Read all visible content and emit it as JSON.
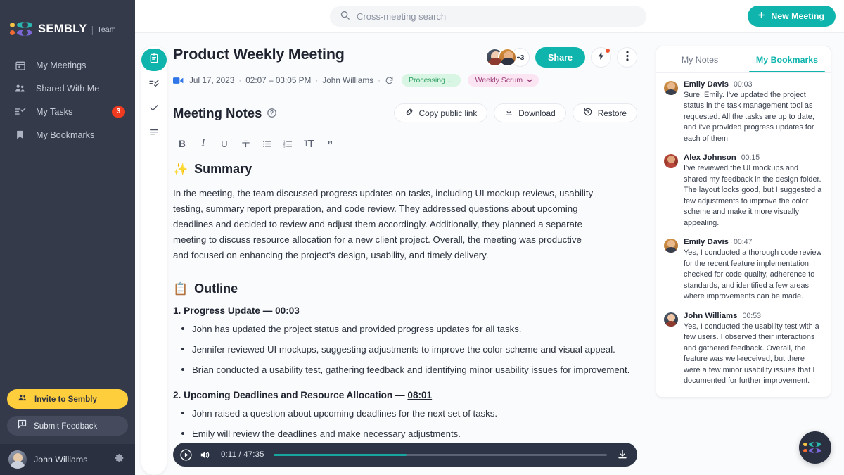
{
  "brand": {
    "name": "SEMBLY",
    "plan": "Team",
    "divider": "|",
    "accent": "#0fb5ad",
    "sidebar_bg": "#353a4a",
    "badge_red": "#f03b20",
    "invite_yellow": "#ffce3d"
  },
  "sidebar": {
    "items": [
      {
        "label": "My Meetings",
        "icon": "calendar-icon",
        "badge": null
      },
      {
        "label": "Shared With Me",
        "icon": "people-icon",
        "badge": null
      },
      {
        "label": "My Tasks",
        "icon": "task-list-icon",
        "badge": "3"
      },
      {
        "label": "My Bookmarks",
        "icon": "bookmark-icon",
        "badge": null
      }
    ],
    "invite_label": "Invite to Sembly",
    "feedback_label": "Submit Feedback",
    "user_name": "John Williams"
  },
  "topbar": {
    "search_placeholder": "Cross-meeting search",
    "search_value": "",
    "new_meeting_label": "New Meeting",
    "plus": "+"
  },
  "rail": {
    "items": [
      {
        "name": "notes-icon",
        "active": true
      },
      {
        "name": "tasks-icon",
        "active": false
      },
      {
        "name": "check-icon",
        "active": false
      },
      {
        "name": "transcript-icon",
        "active": false
      }
    ]
  },
  "meeting": {
    "title": "Product Weekly Meeting",
    "date": "Jul 17, 2023",
    "time_range": "02:07 – 03:05 PM",
    "owner": "John Williams",
    "sep": "·",
    "status_badge": "Processing ...",
    "tag_badge": "Weekly Scrum",
    "avatar_overflow": "+3",
    "share_label": "Share"
  },
  "notes": {
    "heading": "Meeting Notes",
    "actions": [
      {
        "label": "Copy public link",
        "icon": "link-icon"
      },
      {
        "label": "Download",
        "icon": "download-icon"
      },
      {
        "label": "Restore",
        "icon": "restore-icon"
      }
    ],
    "format_tools": [
      {
        "name": "bold-icon",
        "glyph": "B"
      },
      {
        "name": "italic-icon",
        "glyph": "I"
      },
      {
        "name": "underline-icon",
        "glyph": "U"
      },
      {
        "name": "strikethrough-icon",
        "glyph": "S"
      },
      {
        "name": "bullet-list-icon",
        "glyph": ""
      },
      {
        "name": "numbered-list-icon",
        "glyph": ""
      },
      {
        "name": "font-size-icon",
        "glyph": ""
      },
      {
        "name": "quote-icon",
        "glyph": "”"
      }
    ]
  },
  "summary": {
    "emoji": "✨",
    "title": "Summary",
    "text": "In the meeting, the team discussed progress updates on tasks, including UI mockup reviews, usability testing, summary report preparation, and code review. They addressed questions about upcoming deadlines and decided to review and adjust them accordingly. Additionally, they planned a separate meeting to discuss resource allocation for a new client project. Overall, the meeting was productive and focused on enhancing the project's design, usability, and timely delivery."
  },
  "outline": {
    "emoji": "📋",
    "title": "Outline",
    "sections": [
      {
        "number": "1.",
        "heading": "Progress Update",
        "dash": "—",
        "timestamp": "00:03",
        "bullets": [
          "John has updated the project status and provided progress updates for all tasks.",
          "Jennifer reviewed UI mockups, suggesting adjustments to improve the color scheme and visual appeal.",
          "Brian conducted a usability test, gathering feedback and identifying minor usability issues for improvement."
        ]
      },
      {
        "number": "2.",
        "heading": "Upcoming Deadlines and Resource Allocation",
        "dash": "—",
        "timestamp": "08:01",
        "bullets": [
          "John raised a question about upcoming deadlines for the next set of tasks.",
          "Emily will review the deadlines and make necessary adjustments."
        ]
      }
    ]
  },
  "player": {
    "current_time": "0:11",
    "total_time": "47:35",
    "time_display": "0:11 / 47:35",
    "progress_percent": 40,
    "play_icon": "play-icon",
    "volume_icon": "volume-icon",
    "download_icon": "download-icon"
  },
  "right_panel": {
    "tabs": [
      {
        "label": "My Notes",
        "active": false
      },
      {
        "label": "My Bookmarks",
        "active": true
      }
    ],
    "bookmarks": [
      {
        "author": "Emily Davis",
        "time": "00:03",
        "text": "Sure, Emily. I've updated the project status in the task management tool as requested. All the tasks are up to date, and I've provided progress updates for each of them."
      },
      {
        "author": "Alex Johnson",
        "time": "00:15",
        "text": "I've reviewed the UI mockups and shared my feedback in the design folder. The layout looks good, but I suggested a few adjustments to improve the color scheme and make it more visually appealing."
      },
      {
        "author": "Emily Davis",
        "time": "00:47",
        "text": "Yes, I conducted a thorough code review for the recent feature implementation. I checked for code quality, adherence to standards, and identified a few areas where improvements can be made."
      },
      {
        "author": "John Williams",
        "time": "00:53",
        "text": "Yes, I conducted the usability test with a few users. I observed their interactions and gathered feedback. Overall, the feature was well-received, but there were a few minor usability issues that I documented for further improvement."
      }
    ]
  },
  "fab": {
    "name": "sembly-assistant-button"
  }
}
